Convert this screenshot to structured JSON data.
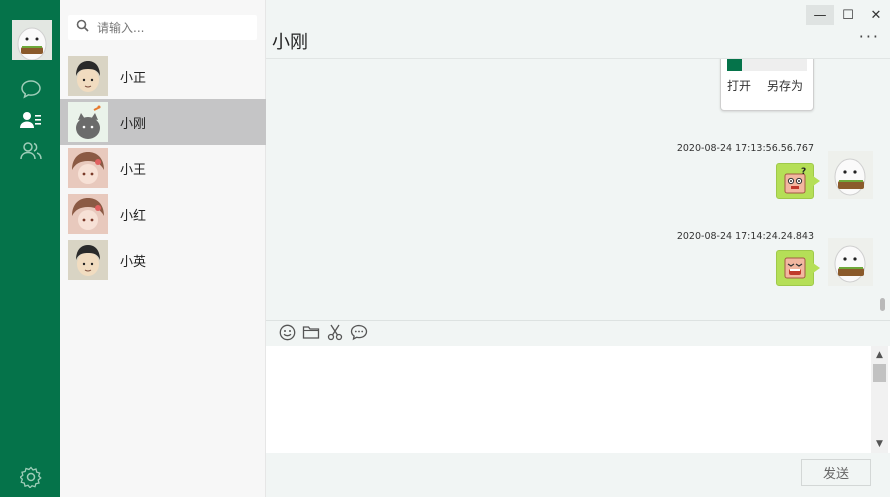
{
  "search": {
    "placeholder": "请输入..."
  },
  "contacts": [
    {
      "name": "小正",
      "active": false
    },
    {
      "name": "小刚",
      "active": true
    },
    {
      "name": "小王",
      "active": false
    },
    {
      "name": "小红",
      "active": false
    },
    {
      "name": "小英",
      "active": false
    }
  ],
  "chat": {
    "title": "小刚",
    "more": "···",
    "file_card": {
      "open_label": "打开",
      "save_as_label": "另存为"
    },
    "messages": [
      {
        "timestamp": "2020-08-24 17:13:56.56.767",
        "sticker": "confused-face-sticker"
      },
      {
        "timestamp": "2020-08-24 17:14:24.24.843",
        "sticker": "laughing-face-sticker"
      }
    ]
  },
  "toolbar": [
    "emoji-icon",
    "folder-icon",
    "scissors-icon",
    "chat-bubble-icon"
  ],
  "input": {
    "value": ""
  },
  "send_label": "发送",
  "window": {
    "minimize": "—",
    "maximize": "☐",
    "close": "✕"
  },
  "colors": {
    "rail": "#05734a",
    "active_contact": "#c5c5c6",
    "bubble": "#b5df57"
  }
}
